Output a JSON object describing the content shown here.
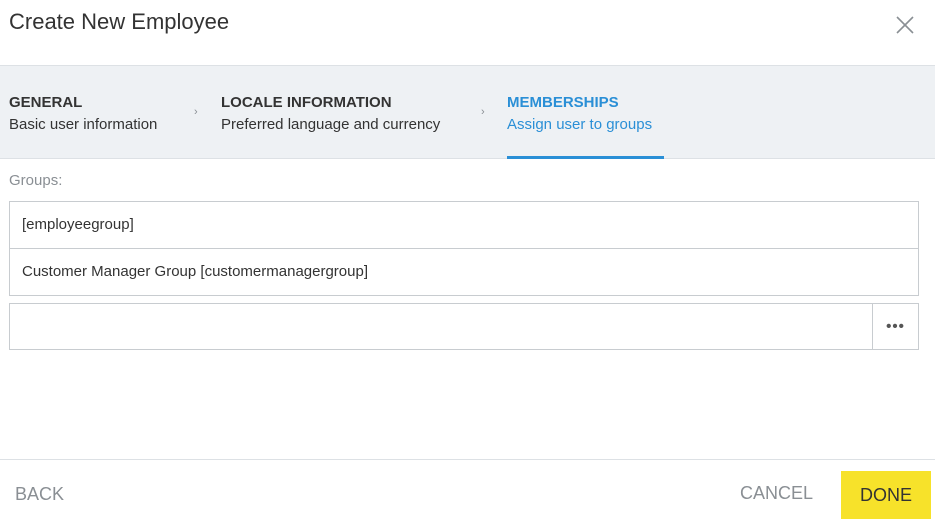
{
  "dialog": {
    "title": "Create New Employee",
    "close_icon": "close-icon"
  },
  "wizard": {
    "steps": [
      {
        "title": "GENERAL",
        "subtitle": "Basic user information",
        "active": false
      },
      {
        "title": "LOCALE INFORMATION",
        "subtitle": "Preferred language and currency",
        "active": false
      },
      {
        "title": "MEMBERSHIPS",
        "subtitle": "Assign user to groups",
        "active": true
      }
    ],
    "separator": "›",
    "active_color": "#2a8fd6"
  },
  "groups": {
    "label": "Groups:",
    "items": [
      "[employeegroup]",
      "Customer Manager Group [customermanagergroup]"
    ],
    "input_value": "",
    "input_placeholder": "",
    "browse_label": "•••",
    "browse_icon": "ellipsis-icon"
  },
  "footer": {
    "back_label": "BACK",
    "cancel_label": "CANCEL",
    "done_label": "DONE",
    "done_color": "#f7e22a"
  }
}
